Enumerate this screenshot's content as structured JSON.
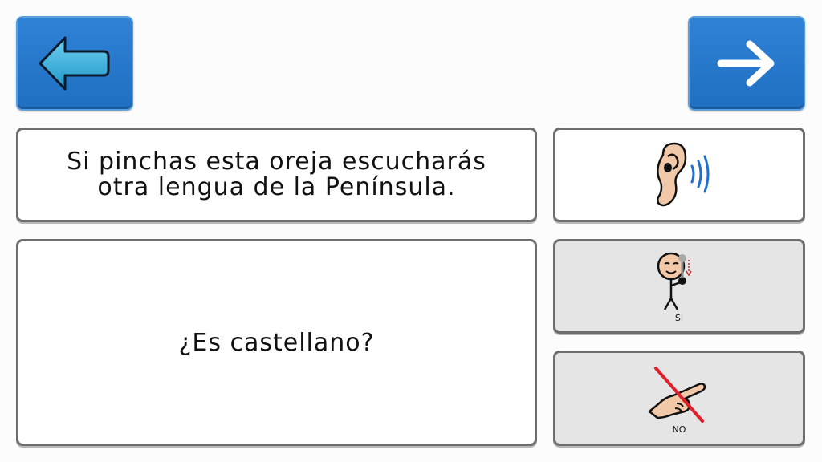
{
  "nav": {
    "back_icon": "arrow-left-icon",
    "next_icon": "arrow-right-icon"
  },
  "message": {
    "text": "Si pinchas esta oreja escucharás\notra lengua de la Península."
  },
  "question": {
    "text": "¿Es castellano?"
  },
  "pictograms": {
    "listen": {
      "icon": "ear-sound-icon"
    },
    "yes": {
      "label": "SI",
      "icon": "person-yes-icon"
    },
    "no": {
      "label": "NO",
      "icon": "pointing-hand-crossed-icon"
    }
  },
  "colors": {
    "nav_blue": "#2a7bd1",
    "back_arrow": "#29a8d8",
    "card_border": "#6e6e6e",
    "crossout_red": "#e0202a",
    "sound_waves": "#1e6fd0"
  }
}
